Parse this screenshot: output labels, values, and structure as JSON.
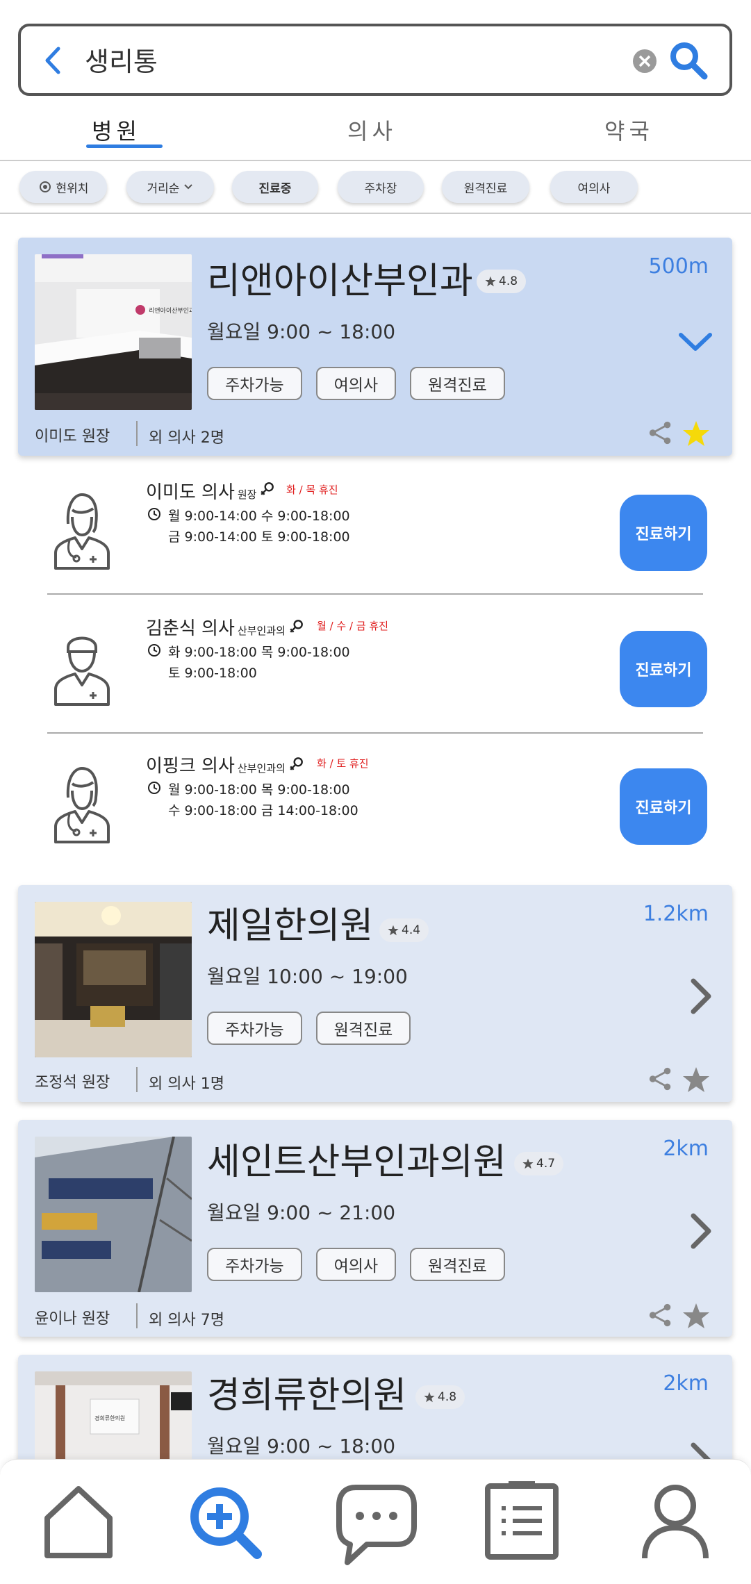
{
  "search": {
    "query": "생리통"
  },
  "tabs": [
    {
      "label": "병원",
      "active": true
    },
    {
      "label": "의사",
      "active": false
    },
    {
      "label": "약국",
      "active": false
    }
  ],
  "filters": {
    "location": "현위치",
    "sort": "거리순",
    "open": "진료중",
    "parking": "주차장",
    "remote": "원격진료",
    "female": "여의사"
  },
  "colors": {
    "accent": "#3c87ef",
    "selected_card": "#c9d9f2",
    "card": "#dfe7f4",
    "closed_day": "#e01e1e",
    "favorite": "#f5d90a"
  },
  "hospitals": [
    {
      "name": "리앤아이산부인과",
      "rating": "4.8",
      "hours": "월요일 9:00 ~ 18:00",
      "tags": [
        "주차가능",
        "여의사",
        "원격진료"
      ],
      "distance": "500m",
      "director": "이미도 원장",
      "others": "외 의사 2명",
      "sign_text": "리앤아이산부인과",
      "expanded": true,
      "favorited": true
    },
    {
      "name": "제일한의원",
      "rating": "4.4",
      "hours": "월요일 10:00 ~ 19:00",
      "tags": [
        "주차가능",
        "원격진료"
      ],
      "distance": "1.2km",
      "director": "조정석 원장",
      "others": "외 의사 1명"
    },
    {
      "name": "세인트산부인과의원",
      "rating": "4.7",
      "hours": "월요일 9:00 ~ 21:00",
      "tags": [
        "주차가능",
        "여의사",
        "원격진료"
      ],
      "distance": "2km",
      "director": "윤이나 원장",
      "others": "외 의사 7명"
    },
    {
      "name": "경희류한의원",
      "rating": "4.8",
      "hours": "월요일 9:00 ~ 18:00",
      "distance": "2km",
      "sign_text": "경희류한의원"
    }
  ],
  "doctors": [
    {
      "name": "이미도 의사",
      "title": "원장",
      "off": "화 / 목 휴진",
      "hours1": "월 9:00-14:00 수 9:00-18:00",
      "hours2": "금 9:00-14:00 토 9:00-18:00",
      "button": "진료하기",
      "gender": "female"
    },
    {
      "name": "김춘식 의사",
      "title": "산부인과의",
      "off": "월 / 수 / 금 휴진",
      "hours1": "화 9:00-18:00 목 9:00-18:00",
      "hours2": "토 9:00-18:00",
      "button": "진료하기",
      "gender": "male"
    },
    {
      "name": "이핑크 의사",
      "title": "산부인과의",
      "off": "화 / 토 휴진",
      "hours1": "월 9:00-18:00 목 9:00-18:00",
      "hours2": "수 9:00-18:00 금 14:00-18:00",
      "button": "진료하기",
      "gender": "female"
    }
  ],
  "bottom_nav": [
    "home-icon",
    "search-plus-icon",
    "chat-icon",
    "document-list-icon",
    "profile-icon"
  ]
}
